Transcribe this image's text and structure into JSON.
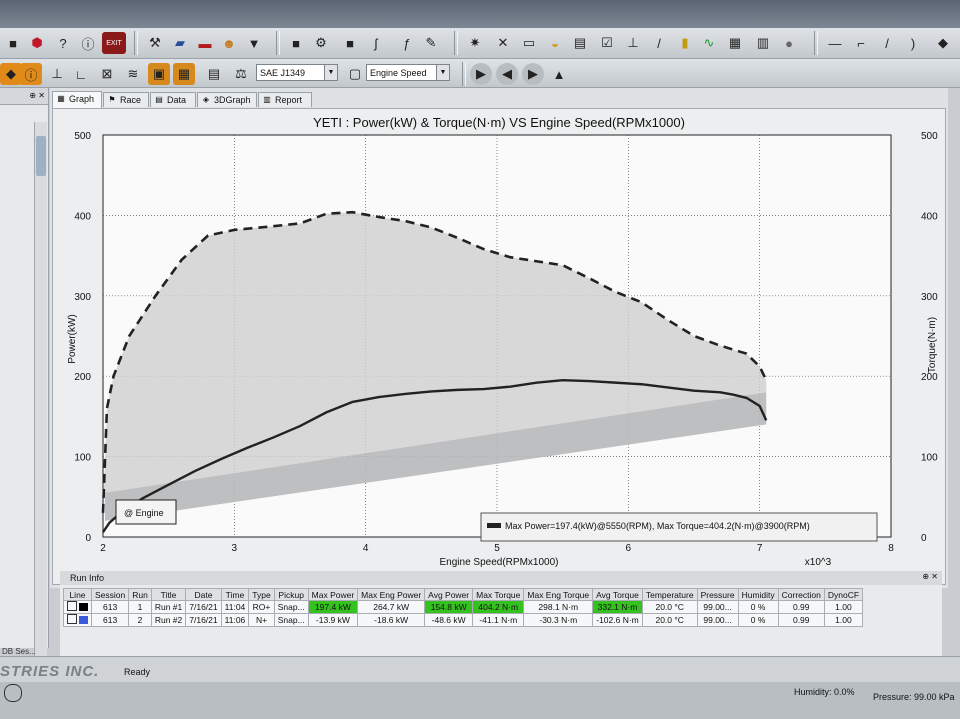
{
  "toolbar": {
    "exit_label": "EXIT",
    "standard_combo": "SAE J1349",
    "xaxis_combo": "Engine Speed"
  },
  "tabs": [
    {
      "label": "Graph"
    },
    {
      "label": "Race"
    },
    {
      "label": "Data"
    },
    {
      "label": "3DGraph"
    },
    {
      "label": "Report"
    }
  ],
  "chart_data": {
    "type": "line",
    "title": "YETI : Power(kW) & Torque(N·m) VS Engine Speed(RPMx1000)",
    "xlabel": "Engine Speed(RPMx1000)",
    "ylabel": "Power(kW)",
    "y2label": "Torque(N·m)",
    "x_multiplier_label": "x10^3",
    "xlim": [
      2,
      8
    ],
    "ylim": [
      0,
      500
    ],
    "y2lim": [
      0,
      500
    ],
    "x_ticks": [
      "2",
      "3",
      "4",
      "5",
      "6",
      "7",
      "8"
    ],
    "y_ticks": [
      "0",
      "100",
      "200",
      "300",
      "400",
      "500"
    ],
    "y2_ticks": [
      "0",
      "100",
      "200",
      "300",
      "400",
      "500"
    ],
    "grid": true,
    "series": [
      {
        "axis": "left",
        "style": "solid",
        "x": [
          2.0,
          2.05,
          2.15,
          2.3,
          2.5,
          2.7,
          2.9,
          3.1,
          3.3,
          3.5,
          3.7,
          3.9,
          4.1,
          4.3,
          4.5,
          4.7,
          4.9,
          5.1,
          5.3,
          5.5,
          5.7,
          5.9,
          6.1,
          6.3,
          6.5,
          6.7,
          6.8,
          6.9,
          7.0,
          7.05
        ],
        "y": [
          6,
          18,
          32,
          48,
          65,
          82,
          97,
          111,
          124,
          138,
          155,
          168,
          174,
          178,
          181,
          183,
          184,
          187,
          192,
          195,
          194,
          192,
          190,
          186,
          182,
          180,
          177,
          173,
          163,
          145
        ]
      },
      {
        "axis": "right",
        "style": "dashed",
        "x": [
          2.0,
          2.03,
          2.08,
          2.2,
          2.4,
          2.6,
          2.8,
          3.0,
          3.2,
          3.5,
          3.7,
          3.9,
          4.1,
          4.3,
          4.5,
          4.7,
          4.9,
          5.1,
          5.3,
          5.5,
          5.7,
          5.9,
          6.1,
          6.3,
          6.5,
          6.7,
          6.9,
          7.0,
          7.05
        ],
        "y": [
          30,
          160,
          200,
          250,
          300,
          345,
          375,
          382,
          385,
          390,
          402,
          404,
          398,
          393,
          385,
          372,
          358,
          348,
          343,
          338,
          322,
          305,
          292,
          270,
          250,
          238,
          228,
          212,
          195
        ]
      }
    ],
    "legend_text": "Max Power=197.4(kW)@5550(RPM), Max Torque=404.2(N·m)@3900(RPM)",
    "engine_label": "@ Engine"
  },
  "run_info": {
    "title": "Run Info",
    "columns": [
      "Line",
      "Session",
      "Run",
      "Title",
      "Date",
      "Time",
      "Type",
      "Pickup",
      "Max Power",
      "Max Eng Power",
      "Avg Power",
      "Max Torque",
      "Max Eng Torque",
      "Avg Torque",
      "Temperature",
      "Pressure",
      "Humidity",
      "Correction",
      "DynoCF"
    ],
    "rows": [
      {
        "session": "613",
        "run": "1",
        "title": "Run #1",
        "date": "7/16/21",
        "time": "11:04",
        "type": "RO+",
        "pickup": "Snap...",
        "max_power": "197.4 kW",
        "max_eng_power": "264.7 kW",
        "avg_power": "154.8 kW",
        "max_torque": "404.2 N·m",
        "max_eng_torque": "298.1 N·m",
        "avg_torque": "332.1 N·m",
        "temperature": "20.0 °C",
        "pressure": "99.00...",
        "humidity": "0 %",
        "correction": "0.99",
        "dynocf": "1.00",
        "color": "#000000"
      },
      {
        "session": "613",
        "run": "2",
        "title": "Run #2",
        "date": "7/16/21",
        "time": "11:06",
        "type": "N+",
        "pickup": "Snap...",
        "max_power": "-13.9 kW",
        "max_eng_power": "-18.6 kW",
        "avg_power": "-48.6 kW",
        "max_torque": "-41.1 N·m",
        "max_eng_torque": "-30.3 N·m",
        "avg_torque": "-102.6 N·m",
        "temperature": "20.0 °C",
        "pressure": "99.00...",
        "humidity": "0 %",
        "correction": "0.99",
        "dynocf": "1.00",
        "color": "#3a5bd9"
      }
    ]
  },
  "status": {
    "logo": "STRIES INC.",
    "ready": "Ready",
    "left_item": "DB Ses...",
    "humidity": "Humidity: 0.0%",
    "pressure": "Pressure: 99.00 kPa"
  },
  "colors": {
    "highlight": "#35c21f",
    "run1": "#000000",
    "run2": "#3a5bd9"
  }
}
